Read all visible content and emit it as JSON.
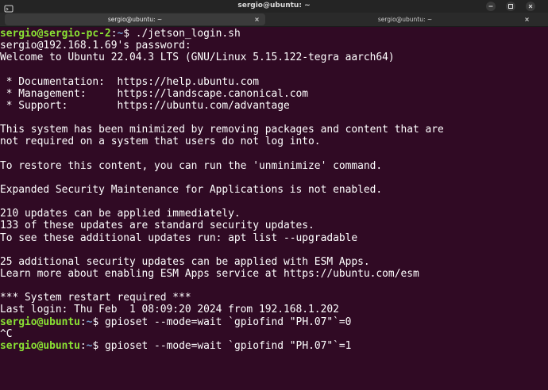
{
  "window": {
    "title": "sergio@ubuntu: ~"
  },
  "tabs": [
    {
      "label": "sergio@ubuntu: ~",
      "active": true
    },
    {
      "label": "sergio@ubuntu: ~",
      "active": false
    }
  ],
  "colors": {
    "background": "#300a24",
    "prompt_user": "#8ae234",
    "prompt_path": "#729fcf",
    "text": "#ffffff"
  },
  "icons": {
    "titlebar_left": "terminal-icon",
    "minimize": "minimize-icon",
    "maximize": "maximize-icon",
    "close": "close-icon",
    "tab_close": "close-icon"
  },
  "terminal": {
    "lines": [
      {
        "type": "prompt",
        "user": "sergio@sergio-pc-2",
        "sep": ":",
        "path": "~",
        "sym": "$ ",
        "cmd": "./jetson_login.sh"
      },
      {
        "type": "text",
        "text": "sergio@192.168.1.69's password:"
      },
      {
        "type": "text",
        "text": "Welcome to Ubuntu 22.04.3 LTS (GNU/Linux 5.15.122-tegra aarch64)"
      },
      {
        "type": "text",
        "text": ""
      },
      {
        "type": "text",
        "text": " * Documentation:  https://help.ubuntu.com"
      },
      {
        "type": "text",
        "text": " * Management:     https://landscape.canonical.com"
      },
      {
        "type": "text",
        "text": " * Support:        https://ubuntu.com/advantage"
      },
      {
        "type": "text",
        "text": ""
      },
      {
        "type": "text",
        "text": "This system has been minimized by removing packages and content that are"
      },
      {
        "type": "text",
        "text": "not required on a system that users do not log into."
      },
      {
        "type": "text",
        "text": ""
      },
      {
        "type": "text",
        "text": "To restore this content, you can run the 'unminimize' command."
      },
      {
        "type": "text",
        "text": ""
      },
      {
        "type": "text",
        "text": "Expanded Security Maintenance for Applications is not enabled."
      },
      {
        "type": "text",
        "text": ""
      },
      {
        "type": "text",
        "text": "210 updates can be applied immediately."
      },
      {
        "type": "text",
        "text": "133 of these updates are standard security updates."
      },
      {
        "type": "text",
        "text": "To see these additional updates run: apt list --upgradable"
      },
      {
        "type": "text",
        "text": ""
      },
      {
        "type": "text",
        "text": "25 additional security updates can be applied with ESM Apps."
      },
      {
        "type": "text",
        "text": "Learn more about enabling ESM Apps service at https://ubuntu.com/esm"
      },
      {
        "type": "text",
        "text": ""
      },
      {
        "type": "text",
        "text": "*** System restart required ***"
      },
      {
        "type": "text",
        "text": "Last login: Thu Feb  1 08:09:20 2024 from 192.168.1.202"
      },
      {
        "type": "prompt",
        "user": "sergio@ubuntu",
        "sep": ":",
        "path": "~",
        "sym": "$ ",
        "cmd": "gpioset --mode=wait `gpiofind \"PH.07\"`=0"
      },
      {
        "type": "text",
        "text": "^C"
      },
      {
        "type": "prompt",
        "user": "sergio@ubuntu",
        "sep": ":",
        "path": "~",
        "sym": "$ ",
        "cmd": "gpioset --mode=wait `gpiofind \"PH.07\"`=1"
      }
    ]
  }
}
